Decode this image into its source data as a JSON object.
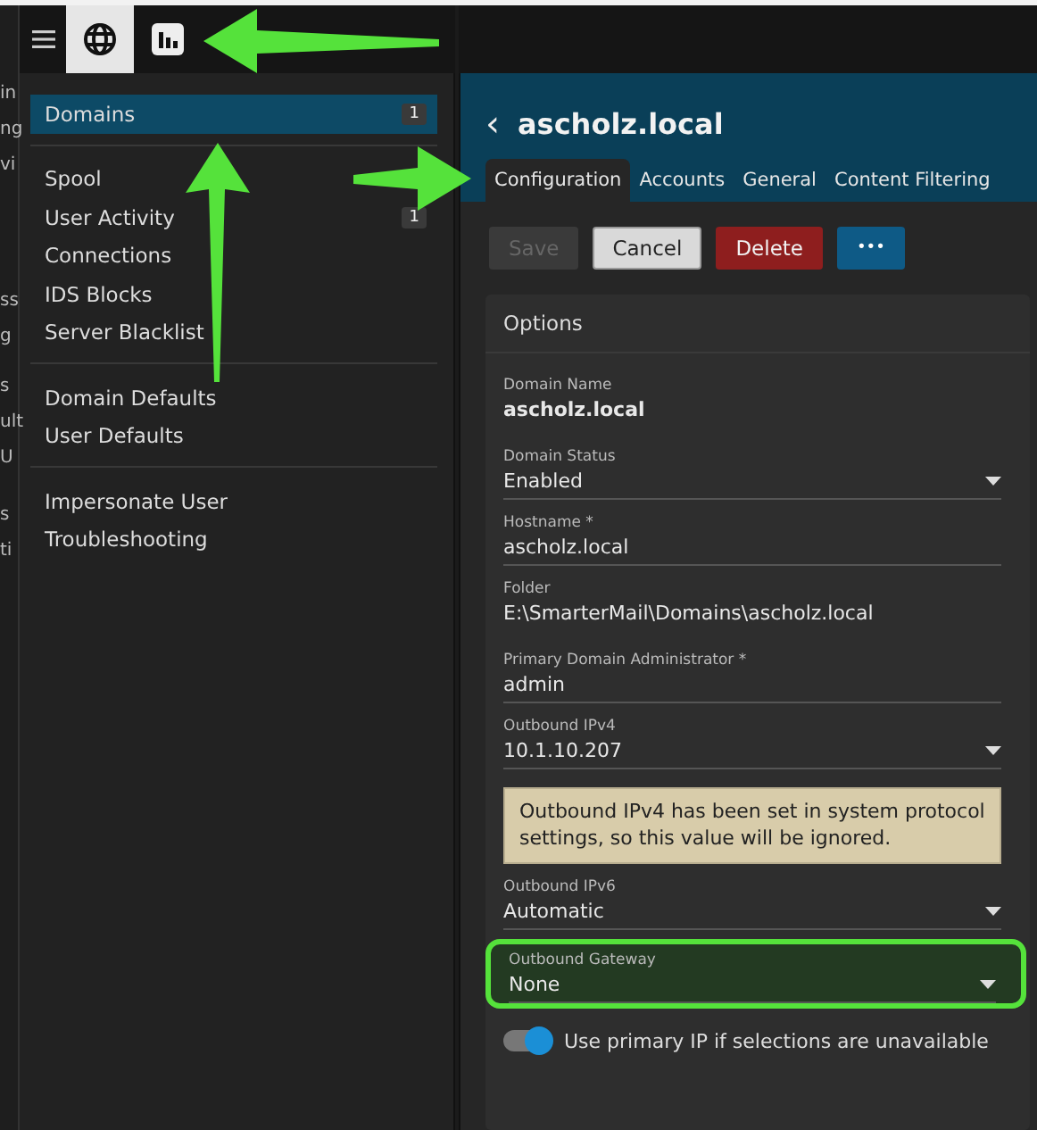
{
  "left_strip": [
    "in",
    "ng",
    "vi",
    "ss",
    "g",
    "s",
    "ult",
    "U",
    "s",
    "ti"
  ],
  "top_tabs": [
    {
      "kind": "globe",
      "selected": true
    },
    {
      "kind": "chart",
      "selected": false
    }
  ],
  "sidebar": {
    "groups": [
      [
        {
          "label": "Domains",
          "badge": "1",
          "selected": true
        }
      ],
      [
        {
          "label": "Spool",
          "selected": false
        },
        {
          "label": "User Activity",
          "badge": "1",
          "selected": false
        },
        {
          "label": "Connections",
          "selected": false
        },
        {
          "label": "IDS Blocks",
          "selected": false
        },
        {
          "label": "Server Blacklist",
          "selected": false
        }
      ],
      [
        {
          "label": "Domain Defaults",
          "selected": false
        },
        {
          "label": "User Defaults",
          "selected": false
        }
      ],
      [
        {
          "label": "Impersonate User",
          "selected": false
        },
        {
          "label": "Troubleshooting",
          "selected": false
        }
      ]
    ]
  },
  "panel": {
    "back": "‹",
    "title": "ascholz.local",
    "tabs": [
      {
        "label": "Configuration",
        "selected": true
      },
      {
        "label": "Accounts",
        "selected": false
      },
      {
        "label": "General",
        "selected": false
      },
      {
        "label": "Content Filtering",
        "selected": false
      }
    ],
    "buttons": [
      {
        "label": "Save",
        "kind": "save",
        "disabled": true
      },
      {
        "label": "Cancel",
        "kind": "cancel",
        "disabled": false
      },
      {
        "label": "Delete",
        "kind": "delete",
        "disabled": false
      },
      {
        "label": "•••",
        "kind": "more",
        "disabled": false
      }
    ],
    "card": {
      "title": "Options",
      "fields": [
        {
          "kind": "static",
          "label": "Domain Name",
          "value": "ascholz.local"
        },
        {
          "kind": "select",
          "label": "Domain Status",
          "value": "Enabled"
        },
        {
          "kind": "input",
          "label": "Hostname *",
          "value": "ascholz.local"
        },
        {
          "kind": "text",
          "label": "Folder",
          "value": "E:\\SmarterMail\\Domains\\ascholz.local"
        },
        {
          "kind": "input",
          "label": "Primary Domain Administrator *",
          "value": "admin"
        },
        {
          "kind": "select",
          "label": "Outbound IPv4",
          "value": "10.1.10.207"
        },
        {
          "kind": "notice",
          "text": "Outbound IPv4 has been set in system protocol settings, so this value will be ignored."
        },
        {
          "kind": "select",
          "label": "Outbound IPv6",
          "value": "Automatic"
        },
        {
          "kind": "select",
          "label": "Outbound Gateway",
          "value": "None",
          "highlighted": true
        },
        {
          "kind": "toggle",
          "label": "Use primary IP if selections are unavailable",
          "on": true
        }
      ]
    }
  },
  "annotations": [
    {
      "kind": "arrow-left"
    },
    {
      "kind": "arrow-up"
    },
    {
      "kind": "arrow-right"
    }
  ]
}
